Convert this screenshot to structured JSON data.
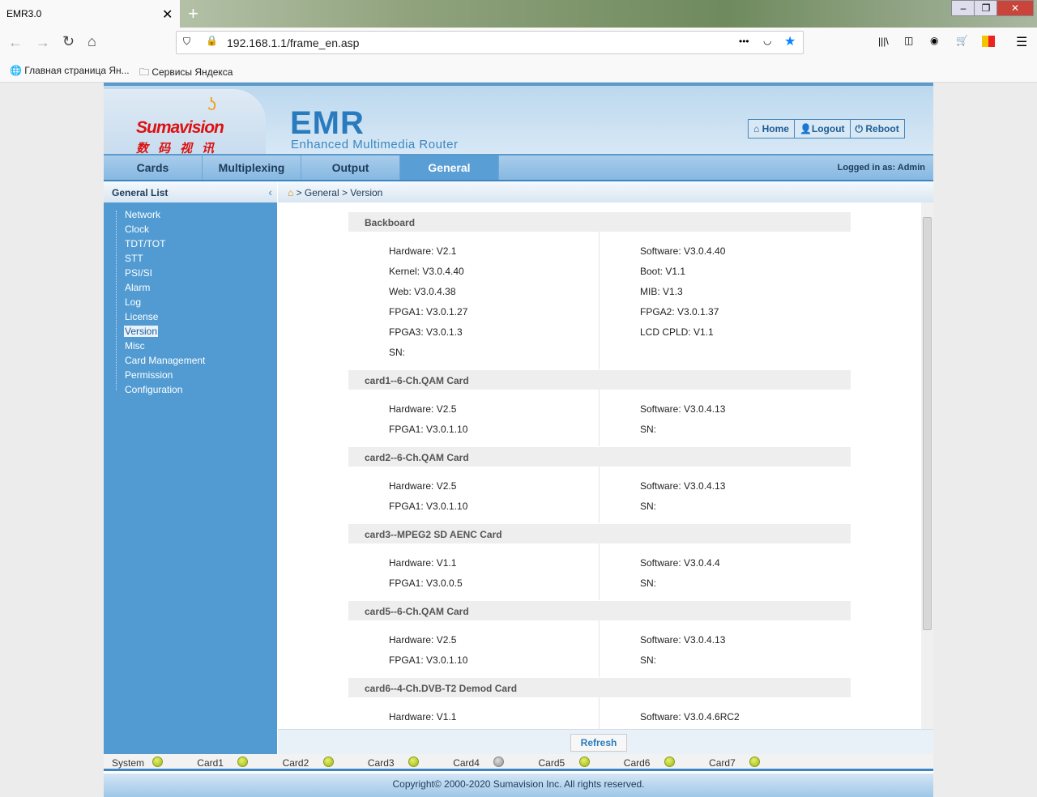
{
  "browser": {
    "tab_title": "EMR3.0",
    "url": "192.168.1.1/frame_en.asp",
    "bookmarks": [
      "Главная страница Ян...",
      "Сервисы Яндекса"
    ]
  },
  "header": {
    "brand": "Sumavision",
    "brand_cn": "数码视讯",
    "product": "EMR",
    "product_sub": "Enhanced Multimedia Router",
    "buttons": [
      "Home",
      "Logout",
      "Reboot"
    ]
  },
  "menu": {
    "items": [
      "Cards",
      "Multiplexing",
      "Output",
      "General"
    ],
    "active": "General",
    "logged_in": "Logged in as: Admin"
  },
  "sidebar": {
    "title": "General List",
    "items": [
      "Network",
      "Clock",
      "TDT/TOT",
      "STT",
      "PSI/SI",
      "Alarm",
      "Log",
      "License",
      "Version",
      "Misc",
      "Card Management",
      "Permission",
      "Configuration"
    ],
    "selected": "Version"
  },
  "breadcrumb": "> General > Version",
  "sections": [
    {
      "title": "Backboard",
      "left": [
        "Hardware: V2.1",
        "Kernel: V3.0.4.40",
        "Web: V3.0.4.38",
        "FPGA1: V3.0.1.27",
        "FPGA3: V3.0.1.3",
        "SN:"
      ],
      "right": [
        "Software: V3.0.4.40",
        "Boot: V1.1",
        "MIB: V1.3",
        "FPGA2: V3.0.1.37",
        "LCD CPLD: V1.1"
      ]
    },
    {
      "title": "card1--6-Ch.QAM Card",
      "left": [
        "Hardware: V2.5",
        "FPGA1: V3.0.1.10"
      ],
      "right": [
        "Software: V3.0.4.13",
        "SN:"
      ]
    },
    {
      "title": "card2--6-Ch.QAM Card",
      "left": [
        "Hardware: V2.5",
        "FPGA1: V3.0.1.10"
      ],
      "right": [
        "Software: V3.0.4.13",
        "SN:"
      ]
    },
    {
      "title": "card3--MPEG2 SD AENC Card",
      "left": [
        "Hardware: V1.1",
        "FPGA1: V3.0.0.5"
      ],
      "right": [
        "Software: V3.0.4.4",
        "SN:"
      ]
    },
    {
      "title": "card5--6-Ch.QAM Card",
      "left": [
        "Hardware: V2.5",
        "FPGA1: V3.0.1.10"
      ],
      "right": [
        "Software: V3.0.4.13",
        "SN:"
      ]
    },
    {
      "title": "card6--4-Ch.DVB-T2 Demod Card",
      "left": [
        "Hardware: V1.1"
      ],
      "right": [
        "Software: V3.0.4.6RC2"
      ]
    }
  ],
  "refresh_label": "Refresh",
  "status": [
    {
      "label": "System",
      "on": true
    },
    {
      "label": "Card1",
      "on": true
    },
    {
      "label": "Card2",
      "on": true
    },
    {
      "label": "Card3",
      "on": true
    },
    {
      "label": "Card4",
      "on": false
    },
    {
      "label": "Card5",
      "on": true
    },
    {
      "label": "Card6",
      "on": true
    },
    {
      "label": "Card7",
      "on": true
    }
  ],
  "footer": "Copyright© 2000-2020 Sumavision Inc. All rights reserved."
}
